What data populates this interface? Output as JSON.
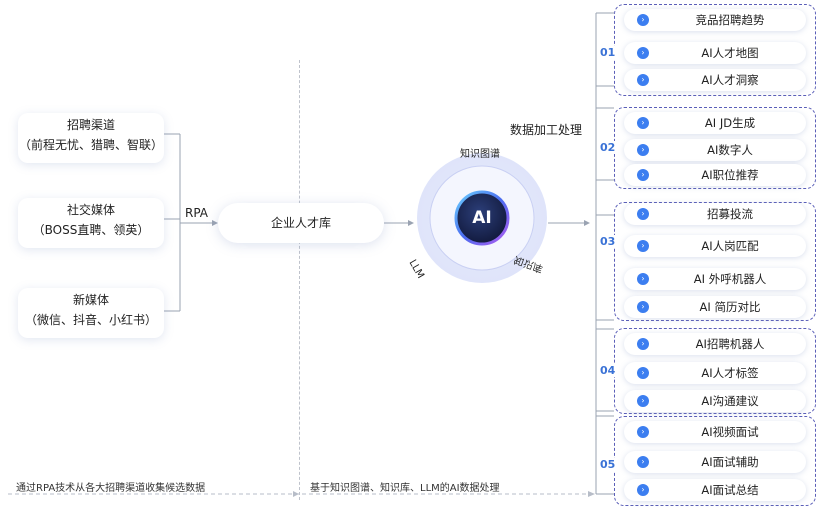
{
  "sources": [
    {
      "line1": "招聘渠道",
      "line2": "（前程无忧、猎聘、智联）"
    },
    {
      "line1": "社交媒体",
      "line2": "（BOSS直聘、领英）"
    },
    {
      "line1": "新媒体",
      "line2": "（微信、抖音、小红书）"
    }
  ],
  "rpa_label": "RPA",
  "talent_pool": "企业人才库",
  "processing_label": "数据加工处理",
  "core": {
    "badge": "AI",
    "ring_labels": {
      "top": "知识图谱",
      "left": "LLM",
      "right": "知识库"
    }
  },
  "groups": [
    {
      "num": "01",
      "items": [
        "竞品招聘趋势",
        "AI人才地图",
        "AI人才洞察"
      ]
    },
    {
      "num": "02",
      "items": [
        "AI JD生成",
        "AI数字人",
        "AI职位推荐"
      ]
    },
    {
      "num": "03",
      "items": [
        "招募投流",
        "AI人岗匹配",
        "AI 外呼机器人",
        "AI 简历对比"
      ]
    },
    {
      "num": "04",
      "items": [
        "AI招聘机器人",
        "AI人才标签",
        "AI沟通建议"
      ]
    },
    {
      "num": "05",
      "items": [
        "AI视频面试",
        "AI面试辅助",
        "AI面试总结"
      ]
    }
  ],
  "footer": {
    "left": "通过RPA技术从各大招聘渠道收集候选数据",
    "middle": "基于知识图谱、知识库、LLM的AI数据处理"
  },
  "colors": {
    "accent": "#3c7ef0",
    "group_border": "#5b5fb8",
    "core_dark": "#1f2d5c"
  },
  "icons": {
    "item": "chevron-right-circle-icon"
  }
}
